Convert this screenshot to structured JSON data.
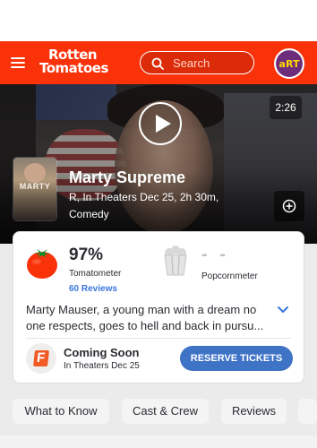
{
  "header": {
    "logo_line1": "Rotten",
    "logo_line2": "Tomatoes",
    "search_placeholder": "Search",
    "avatar_text": "aRT",
    "brand_color": "#fa320a"
  },
  "trailer": {
    "duration": "2:26"
  },
  "movie": {
    "poster_text": "MARTY",
    "title": "Marty Supreme",
    "meta_line1": "R, In Theaters Dec 25, 2h 30m,",
    "meta_line2": "Comedy"
  },
  "scores": {
    "tomatometer_value": "97%",
    "tomatometer_label": "Tomatometer",
    "reviews_link": "60 Reviews",
    "popcornmeter_value": "- -",
    "popcornmeter_label": "Popcornmeter"
  },
  "synopsis": "Marty Mauser, a young man with a dream no one respects, goes to hell and back in pursu...",
  "tickets": {
    "status": "Coming Soon",
    "date": "In Theaters Dec 25",
    "button_label": "RESERVE TICKETS"
  },
  "tabs": [
    "What to Know",
    "Cast & Crew",
    "Reviews"
  ]
}
